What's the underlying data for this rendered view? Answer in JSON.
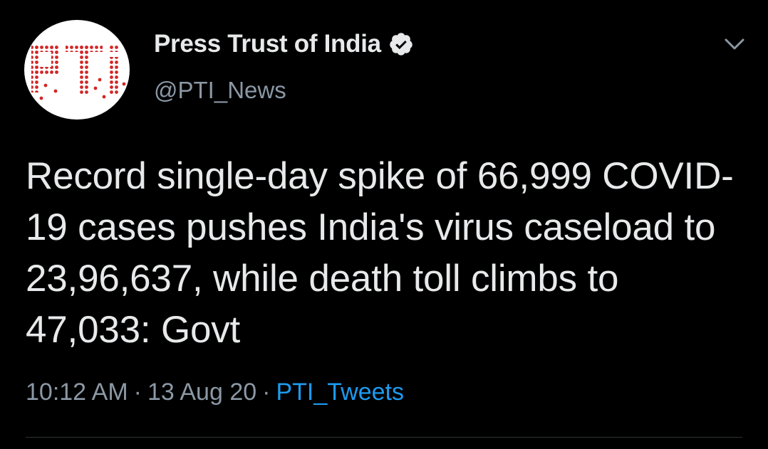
{
  "tweet": {
    "author": {
      "display_name": "Press Trust of India",
      "handle": "@PTI_News",
      "avatar_logo_text": "PTI",
      "verified": true
    },
    "text": "Record single-day spike of 66,999 COVID-19 cases pushes India's virus caseload to 23,96,637, while death toll climbs to 47,033: Govt",
    "time": "10:12 AM",
    "date": "13 Aug 20",
    "source": "PTI_Tweets",
    "separator": "·"
  },
  "icons": {
    "verified": "verified-badge-icon",
    "menu": "chevron-down-icon"
  },
  "colors": {
    "background": "#000000",
    "text": "#e7e9ea",
    "secondary": "#8b98a5",
    "link": "#1d9bf0",
    "logo": "#d42626"
  }
}
